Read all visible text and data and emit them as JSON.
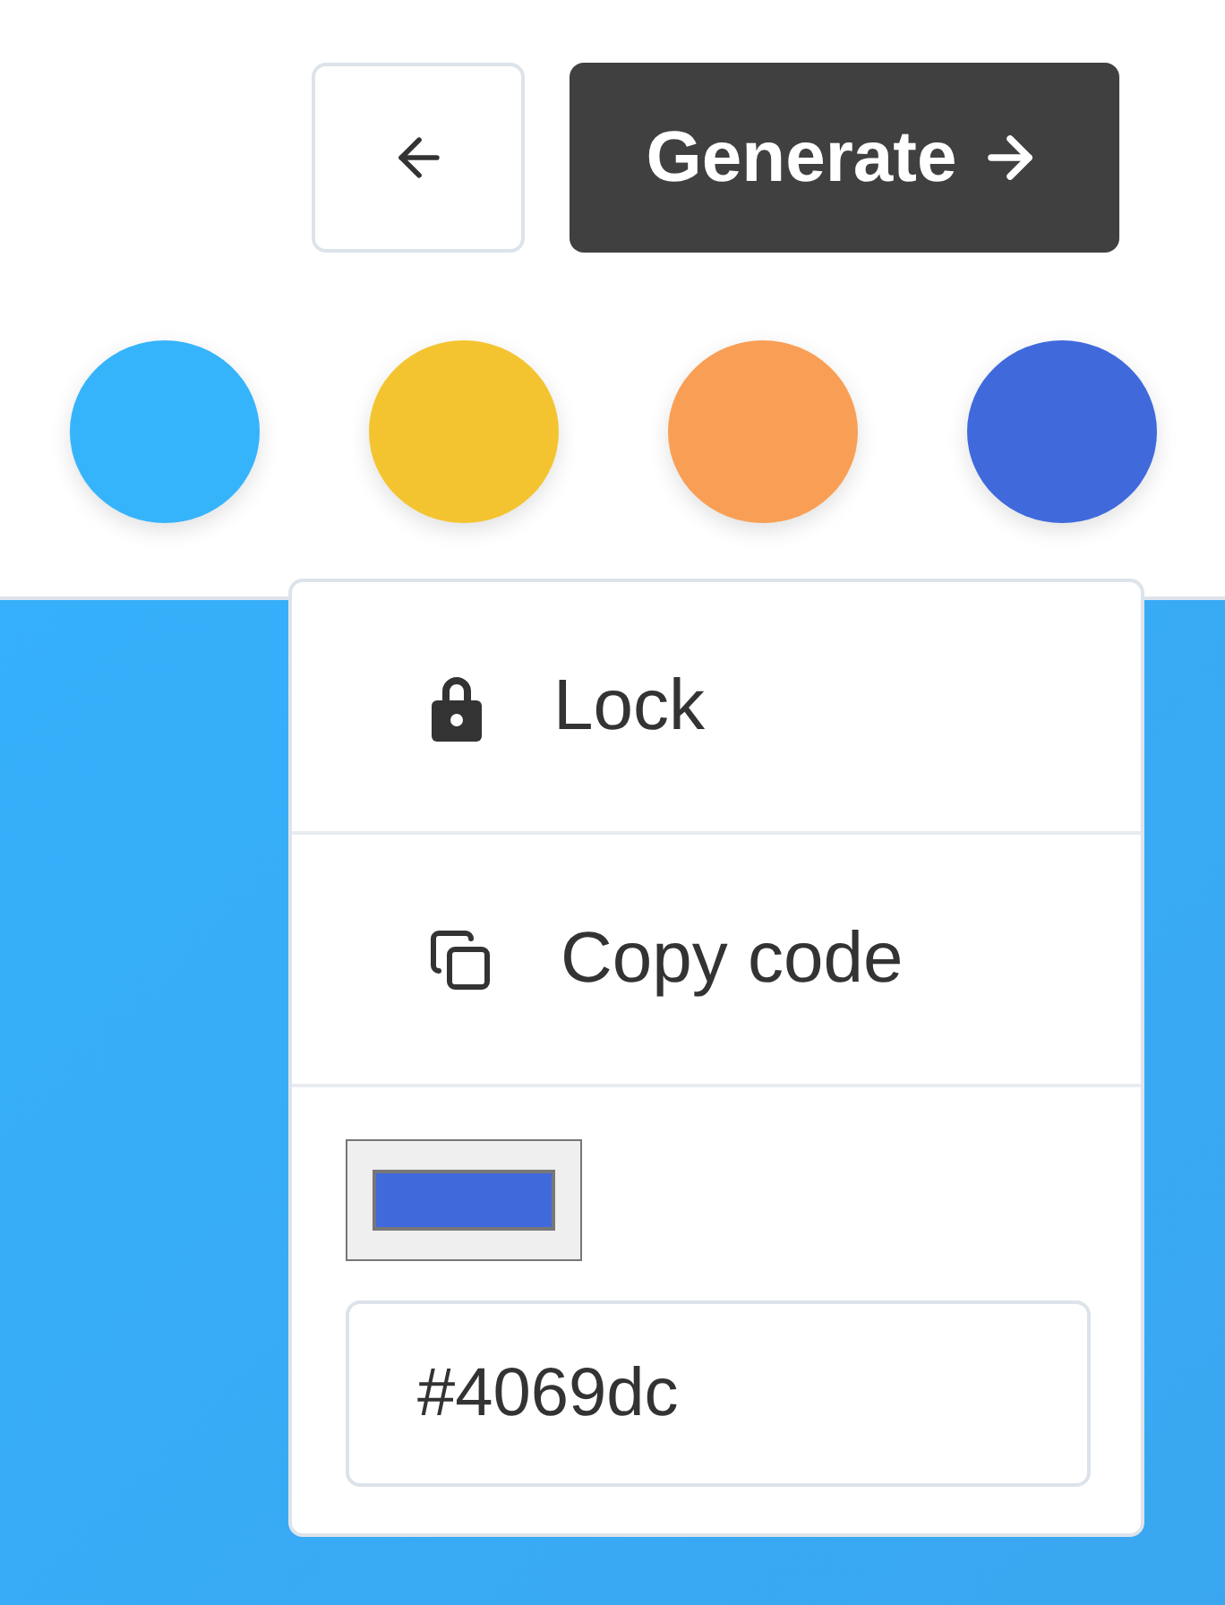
{
  "toolbar": {
    "back_button": {
      "kind": "back"
    },
    "generate_button": {
      "label": "Generate"
    }
  },
  "swatches": [
    {
      "color": "#36b4fb"
    },
    {
      "color": "#f4c430"
    },
    {
      "color": "#f99f55"
    },
    {
      "color": "#4069dc"
    }
  ],
  "menu": {
    "items": [
      {
        "kind": "lock",
        "label": "Lock"
      },
      {
        "kind": "copy",
        "label": "Copy code"
      }
    ],
    "picker": {
      "color": "#4069dc",
      "hex_value": "#4069dc"
    }
  }
}
